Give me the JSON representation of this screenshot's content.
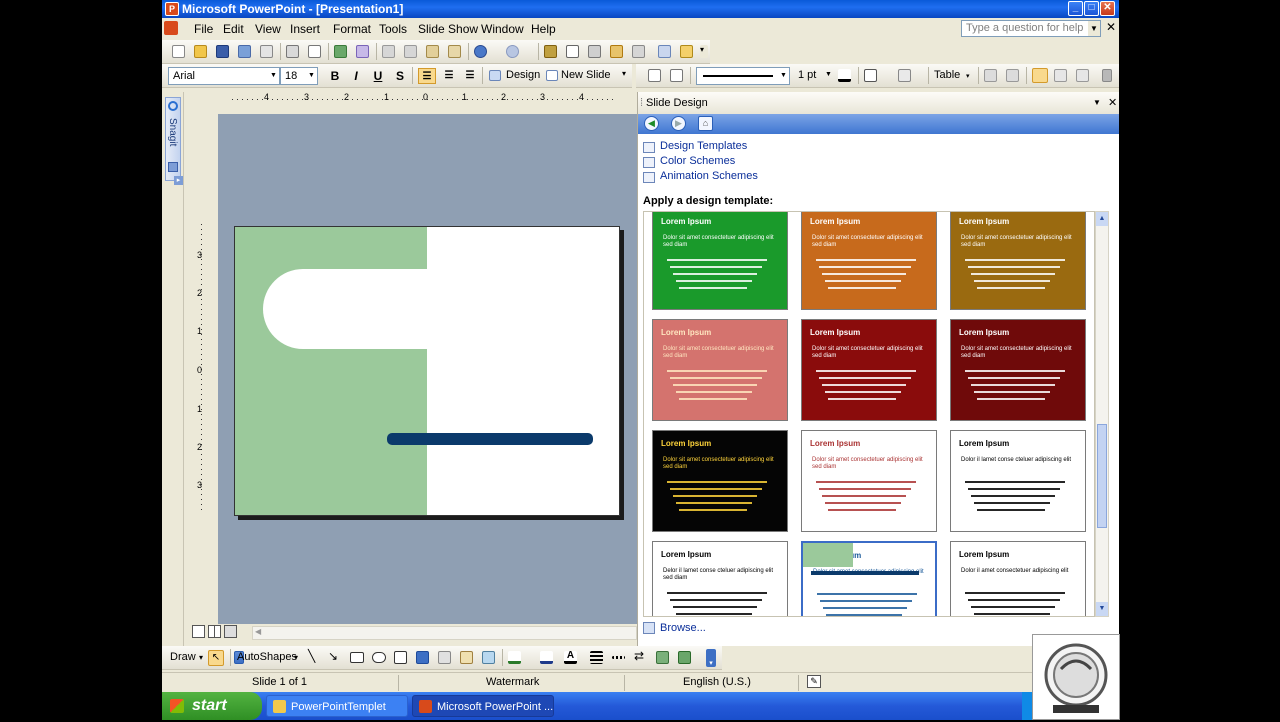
{
  "window": {
    "title": "Microsoft PowerPoint - [Presentation1]",
    "min": "_",
    "max": "□",
    "close": "✕"
  },
  "menu": [
    "File",
    "Edit",
    "View",
    "Insert",
    "Format",
    "Tools",
    "Slide Show",
    "Window",
    "Help"
  ],
  "help": {
    "placeholder": "Type a question for help",
    "close": "✕"
  },
  "format_toolbar": {
    "font": "Arial",
    "size": "18",
    "bold": "B",
    "italic": "I",
    "underline": "U",
    "shadow": "S",
    "design": "Design",
    "new_slide": "New Slide",
    "line_weight": "1 pt",
    "table": "Table"
  },
  "snagit": {
    "label": "Snagit"
  },
  "task_pane": {
    "title": "Slide Design",
    "links": [
      "Design Templates",
      "Color Schemes",
      "Animation Schemes"
    ],
    "apply_heading": "Apply a design template:",
    "browse": "Browse...",
    "templates": [
      {
        "title": "Lorem Ipsum",
        "line1": "Dolor sit amet consectetuer adipiscing elit sed diam",
        "bg": "#1a9a2b",
        "fg": "#ffffff"
      },
      {
        "title": "Lorem Ipsum",
        "line1": "Dolor sit amet consectetuer adipiscing elit sed diam",
        "bg": "#c76a1c",
        "fg": "#ffffff"
      },
      {
        "title": "Lorem Ipsum",
        "line1": "Dolor sit amet consectetuer adipiscing elit sed diam",
        "bg": "#9a6a10",
        "fg": "#ffffff"
      },
      {
        "title": "Lorem Ipsum",
        "line1": "Dolor sit amet consectetuer adipiscing elit sed diam",
        "bg": "#d4736e",
        "fg": "#ffe6c0"
      },
      {
        "title": "Lorem Ipsum",
        "line1": "Dolor sit amet consectetuer adipiscing elit sed diam",
        "bg": "#8a0c0c",
        "fg": "#ffffff"
      },
      {
        "title": "Lorem Ipsum",
        "line1": "Dolor sit amet consectetuer adipiscing elit sed diam",
        "bg": "#6f0a0a",
        "fg": "#ffffff"
      },
      {
        "title": "Lorem Ipsum",
        "line1": "Dolor sit amet consectetuer adipiscing elit sed diam",
        "bg": "#050505",
        "fg": "#ffd43b"
      },
      {
        "title": "Lorem Ipsum",
        "line1": "Dolor sit amet consectetuer adipiscing elit sed diam",
        "bg": "#ffffff",
        "fg": "#a33"
      },
      {
        "title": "Lorem Ipsum",
        "line1": "Dolor il lamet conse cteluer adipiscing elit",
        "bg": "#ffffff",
        "fg": "#000000"
      },
      {
        "title": "Lorem Ipsum",
        "line1": "Delor il lamet conse cteluer adipiscing elit sed diam",
        "bg": "#ffffff",
        "fg": "#000000"
      },
      {
        "title": "Lorem Ipsum",
        "line1": "Dolor sit amet consectetuer adipiscing elit",
        "bg": "#ffffff",
        "fg": "#1a5a9a"
      },
      {
        "title": "Lorem Ipsum",
        "line1": "Dolor il amet consectetuer adipiscing elit",
        "bg": "#ffffff",
        "fg": "#000000"
      }
    ]
  },
  "draw_toolbar": {
    "draw": "Draw",
    "autoshapes": "AutoShapes"
  },
  "status": {
    "slide": "Slide 1 of 1",
    "design": "Watermark",
    "language": "English (U.S.)"
  },
  "taskbar": {
    "start": "start",
    "item1": "PowerPointTemplet",
    "item2": "Microsoft PowerPoint ..."
  },
  "ruler": {
    "h": [
      "4",
      "3",
      "2",
      "1",
      "0",
      "1",
      "2",
      "3",
      "4"
    ],
    "v": [
      "3",
      "2",
      "1",
      "0",
      "1",
      "2",
      "3"
    ]
  }
}
